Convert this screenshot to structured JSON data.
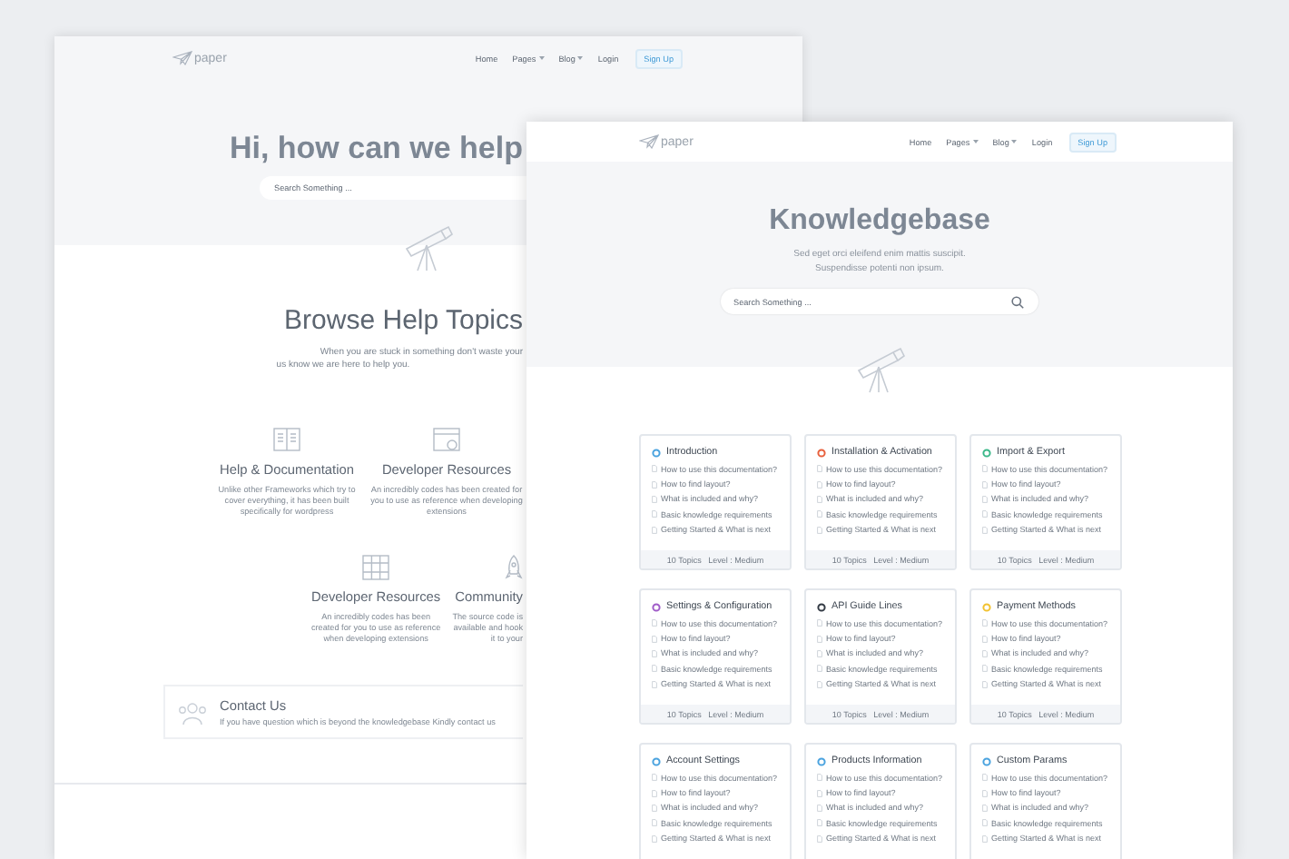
{
  "back_page": {
    "nav": {
      "logo": "paper",
      "links": [
        {
          "label": "Home",
          "dropdown": false
        },
        {
          "label": "Pages",
          "dropdown": true
        },
        {
          "label": "Blog",
          "dropdown": true
        },
        {
          "label": "Login",
          "dropdown": false
        }
      ],
      "signup_button": "Sign Up"
    },
    "hero": {
      "title": "Hi, how can we help",
      "search": {
        "placeholder": "Search Something ..."
      }
    },
    "topics": {
      "title": "Browse Help Topics",
      "subtitle": [
        "When you are stuck in something don't waste your",
        "us know we are here to help you."
      ],
      "features": [
        {
          "title": "Help & Documentation",
          "description": "Unlike other Frameworks which try to cover everything, it has been built specifically for wordpress"
        },
        {
          "title": "Developer Resources",
          "description": "An incredibly codes has been created for you to use as reference when developing extensions"
        },
        {
          "title": "Developer Resources",
          "description": "An incredibly codes has been created for you to use as reference when developing extensions"
        },
        {
          "title": "Community",
          "description": "The source code is available and hook it to your"
        }
      ]
    },
    "contact": {
      "title": "Contact Us",
      "text": "If you have question which is beyond the knowledgebase Kindly contact us"
    }
  },
  "front_page": {
    "nav": {
      "logo": "paper",
      "links": [
        {
          "label": "Home",
          "dropdown": false
        },
        {
          "label": "Pages",
          "dropdown": true
        },
        {
          "label": "Blog",
          "dropdown": true
        },
        {
          "label": "Login",
          "dropdown": false
        }
      ],
      "signup_button": "Sign Up"
    },
    "hero": {
      "title": "Knowledgebase",
      "subtitle": [
        "Sed eget orci eleifend enim mattis suscipit.",
        "Suspendisse potenti non ipsum."
      ],
      "search": {
        "placeholder": "Search Something ..."
      }
    },
    "cards": [
      {
        "title": "Introduction",
        "color": "#4aa3df",
        "links": [
          "How to use this documentation?",
          "How to find layout?",
          "What is included and why?",
          "Basic knowledge requirements",
          "Getting Started & What is next"
        ],
        "footer": "10 Topics   Level : Medium"
      },
      {
        "title": "Installation & Activation",
        "color": "#e8603c",
        "links": [
          "How to use this documentation?",
          "How to find layout?",
          "What is included and why?",
          "Basic knowledge requirements",
          "Getting Started & What is next"
        ],
        "footer": "10 Topics   Level : Medium"
      },
      {
        "title": "Import & Export",
        "color": "#3cb88a",
        "links": [
          "How to use this documentation?",
          "How to find layout?",
          "What is included and why?",
          "Basic knowledge requirements",
          "Getting Started & What is next"
        ],
        "footer": "10 Topics   Level : Medium"
      },
      {
        "title": "Settings & Configuration",
        "color": "#a05cc8",
        "links": [
          "How to use this documentation?",
          "How to find layout?",
          "What is included and why?",
          "Basic knowledge requirements",
          "Getting Started & What is next"
        ],
        "footer": "10 Topics   Level : Medium"
      },
      {
        "title": "API Guide Lines",
        "color": "#333a44",
        "links": [
          "How to use this documentation?",
          "How to find layout?",
          "What is included and why?",
          "Basic knowledge requirements",
          "Getting Started & What is next"
        ],
        "footer": "10 Topics   Level : Medium"
      },
      {
        "title": "Payment Methods",
        "color": "#f2c230",
        "links": [
          "How to use this documentation?",
          "How to find layout?",
          "What is included and why?",
          "Basic knowledge requirements",
          "Getting Started & What is next"
        ],
        "footer": "10 Topics   Level : Medium"
      },
      {
        "title": "Account Settings",
        "color": "#4aa3df",
        "links": [
          "How to use this documentation?",
          "How to find layout?",
          "What is included and why?",
          "Basic knowledge requirements",
          "Getting Started & What is next"
        ]
      },
      {
        "title": "Products Information",
        "color": "#4aa3df",
        "links": [
          "How to use this documentation?",
          "How to find layout?",
          "What is included and why?",
          "Basic knowledge requirements",
          "Getting Started & What is next"
        ]
      },
      {
        "title": "Custom Params",
        "color": "#4aa3df",
        "links": [
          "How to use this documentation?",
          "How to find layout?",
          "What is included and why?",
          "Basic knowledge requirements",
          "Getting Started & What is next"
        ]
      }
    ]
  }
}
